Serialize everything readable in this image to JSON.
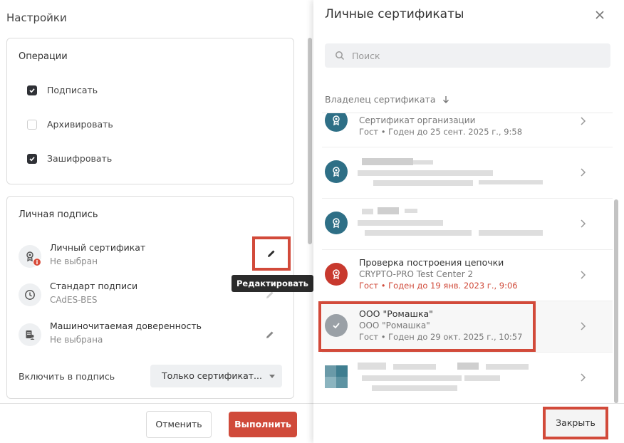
{
  "left": {
    "title": "Настройки",
    "operations": {
      "title": "Операции",
      "items": [
        {
          "label": "Подписать",
          "checked": true
        },
        {
          "label": "Архивировать",
          "checked": false
        },
        {
          "label": "Зашифровать",
          "checked": true
        }
      ]
    },
    "personal_signature": {
      "title": "Личная подпись",
      "rows": [
        {
          "name": "Личный сертификат",
          "value": "Не выбран",
          "icon": "certificate-icon"
        },
        {
          "name": "Стандарт подписи",
          "value": "CAdES-BES",
          "icon": "clock-icon"
        },
        {
          "name": "Машиночитаемая доверенность",
          "value": "Не выбрана",
          "icon": "document-person-icon"
        }
      ],
      "tooltip": "Редактировать",
      "include_label": "Включить в подпись",
      "include_value": "Только сертификат..."
    },
    "cancel_label": "Отменить",
    "run_label": "Выполнить",
    "colors": {
      "accent": "#d04a3a",
      "dark": "#2f3136"
    }
  },
  "right": {
    "title": "Личные сертификаты",
    "search_placeholder": "Поиск",
    "sort_label": "Владелец сертификата",
    "certs": [
      {
        "line1": "",
        "line2": "Сертификат организации",
        "line3": "Гост • Годен до 25 сент. 2025 г., 9:58",
        "color": "#2e6f86",
        "error": false
      },
      {
        "line1": "",
        "line2": "",
        "line3": "",
        "color": "#2e6f86",
        "error": false
      },
      {
        "line1": "",
        "line2": "",
        "line3": "",
        "color": "#2e6f86",
        "error": false
      },
      {
        "line1": "Проверка построения цепочки",
        "line2": "CRYPTO-PRO Test Center 2",
        "line3": "Гост • Годен до 19 янв. 2023 г., 9:06",
        "color": "#c8392e",
        "error": true
      },
      {
        "line1": "ООО \"Ромашка\"",
        "line2": "ООО \"Ромашка\"",
        "line3": "Гост • Годен до 29 окт. 2025 г., 10:57",
        "color": "#9aa0a6",
        "error": false
      },
      {
        "line1": "",
        "line2": "",
        "line3": "",
        "color": "#4a8a9a",
        "error": false
      }
    ],
    "close_label": "Закрыть"
  }
}
